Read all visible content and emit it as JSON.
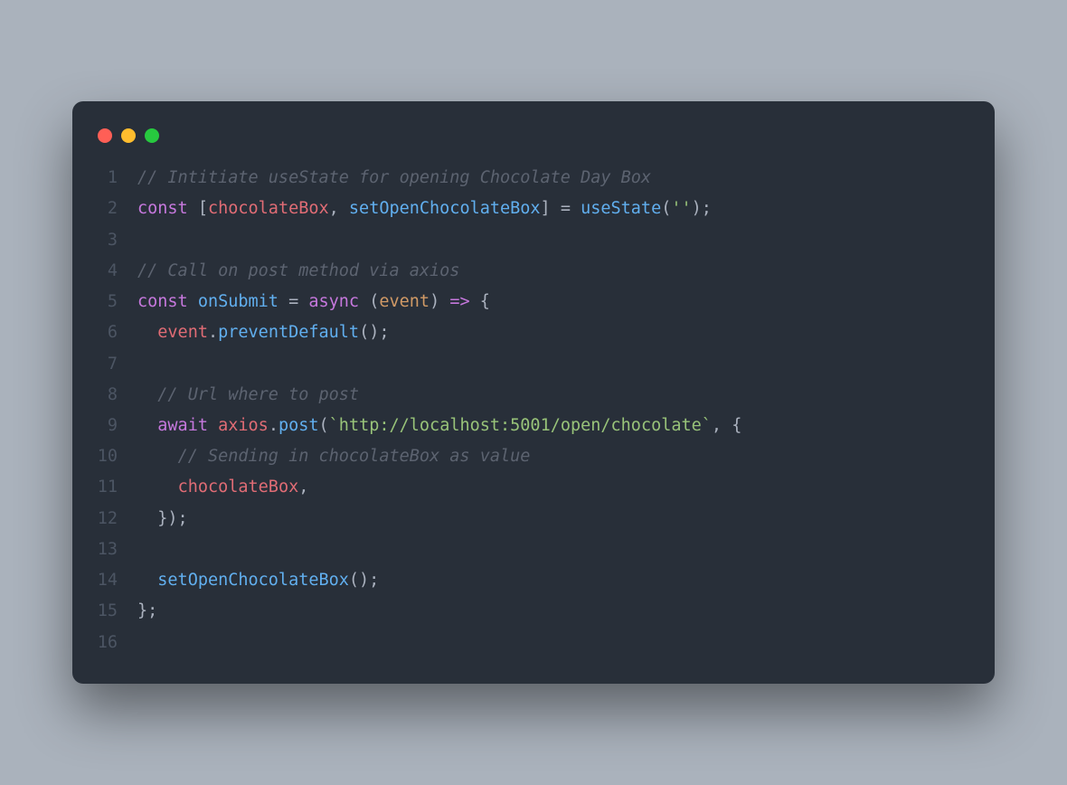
{
  "window": {
    "dots": [
      "red",
      "yellow",
      "green"
    ]
  },
  "code": {
    "lines": [
      {
        "n": "1",
        "tokens": [
          {
            "cls": "tok-comment",
            "t": "// Intitiate useState for opening Chocolate Day Box"
          }
        ]
      },
      {
        "n": "2",
        "tokens": [
          {
            "cls": "tok-keyword",
            "t": "const"
          },
          {
            "cls": "tok-punct",
            "t": " ["
          },
          {
            "cls": "tok-var",
            "t": "chocolateBox"
          },
          {
            "cls": "tok-punct",
            "t": ", "
          },
          {
            "cls": "tok-func",
            "t": "setOpenChocolateBox"
          },
          {
            "cls": "tok-punct",
            "t": "] = "
          },
          {
            "cls": "tok-func",
            "t": "useState"
          },
          {
            "cls": "tok-punct",
            "t": "("
          },
          {
            "cls": "tok-string",
            "t": "''"
          },
          {
            "cls": "tok-punct",
            "t": ");"
          }
        ]
      },
      {
        "n": "3",
        "tokens": [
          {
            "cls": "tok-default",
            "t": ""
          }
        ]
      },
      {
        "n": "4",
        "tokens": [
          {
            "cls": "tok-comment",
            "t": "// Call on post method via axios"
          }
        ]
      },
      {
        "n": "5",
        "tokens": [
          {
            "cls": "tok-keyword",
            "t": "const"
          },
          {
            "cls": "tok-default",
            "t": " "
          },
          {
            "cls": "tok-func",
            "t": "onSubmit"
          },
          {
            "cls": "tok-punct",
            "t": " = "
          },
          {
            "cls": "tok-keyword",
            "t": "async"
          },
          {
            "cls": "tok-punct",
            "t": " ("
          },
          {
            "cls": "tok-param",
            "t": "event"
          },
          {
            "cls": "tok-punct",
            "t": ") "
          },
          {
            "cls": "tok-keyword",
            "t": "=>"
          },
          {
            "cls": "tok-punct",
            "t": " {"
          }
        ]
      },
      {
        "n": "6",
        "tokens": [
          {
            "cls": "tok-default",
            "t": "  "
          },
          {
            "cls": "tok-var",
            "t": "event"
          },
          {
            "cls": "tok-punct",
            "t": "."
          },
          {
            "cls": "tok-func",
            "t": "preventDefault"
          },
          {
            "cls": "tok-punct",
            "t": "();"
          }
        ]
      },
      {
        "n": "7",
        "tokens": [
          {
            "cls": "tok-default",
            "t": ""
          }
        ]
      },
      {
        "n": "8",
        "tokens": [
          {
            "cls": "tok-default",
            "t": "  "
          },
          {
            "cls": "tok-comment",
            "t": "// Url where to post"
          }
        ]
      },
      {
        "n": "9",
        "tokens": [
          {
            "cls": "tok-default",
            "t": "  "
          },
          {
            "cls": "tok-keyword",
            "t": "await"
          },
          {
            "cls": "tok-default",
            "t": " "
          },
          {
            "cls": "tok-var",
            "t": "axios"
          },
          {
            "cls": "tok-punct",
            "t": "."
          },
          {
            "cls": "tok-func",
            "t": "post"
          },
          {
            "cls": "tok-punct",
            "t": "("
          },
          {
            "cls": "tok-string",
            "t": "`http://localhost:5001/open/chocolate`"
          },
          {
            "cls": "tok-punct",
            "t": ", {"
          }
        ]
      },
      {
        "n": "10",
        "tokens": [
          {
            "cls": "tok-default",
            "t": "    "
          },
          {
            "cls": "tok-comment",
            "t": "// Sending in chocolateBox as value"
          }
        ]
      },
      {
        "n": "11",
        "tokens": [
          {
            "cls": "tok-default",
            "t": "    "
          },
          {
            "cls": "tok-var",
            "t": "chocolateBox"
          },
          {
            "cls": "tok-punct",
            "t": ","
          }
        ]
      },
      {
        "n": "12",
        "tokens": [
          {
            "cls": "tok-default",
            "t": "  "
          },
          {
            "cls": "tok-punct",
            "t": "});"
          }
        ]
      },
      {
        "n": "13",
        "tokens": [
          {
            "cls": "tok-default",
            "t": ""
          }
        ]
      },
      {
        "n": "14",
        "tokens": [
          {
            "cls": "tok-default",
            "t": "  "
          },
          {
            "cls": "tok-func",
            "t": "setOpenChocolateBox"
          },
          {
            "cls": "tok-punct",
            "t": "();"
          }
        ]
      },
      {
        "n": "15",
        "tokens": [
          {
            "cls": "tok-punct",
            "t": "};"
          }
        ]
      },
      {
        "n": "16",
        "tokens": [
          {
            "cls": "tok-default",
            "t": ""
          }
        ]
      }
    ]
  }
}
